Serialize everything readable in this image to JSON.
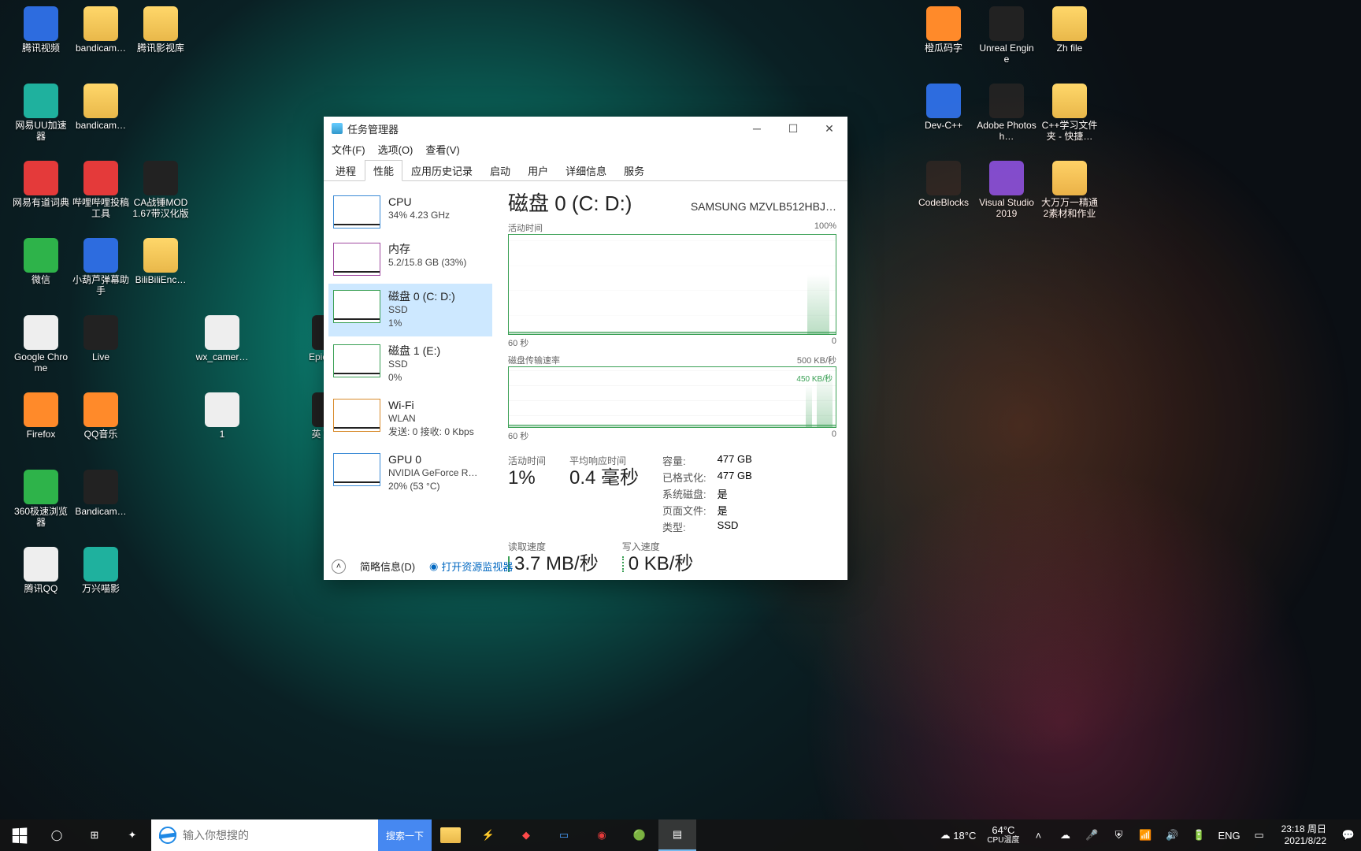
{
  "desktop_icons_left": [
    {
      "label": "腾讯视频",
      "cls": "blue"
    },
    {
      "label": "bandicam…",
      "cls": "folder"
    },
    {
      "label": "腾讯影视库",
      "cls": "folder"
    },
    {
      "label": "网易UU加速器",
      "cls": "teal"
    },
    {
      "label": "bandicam…",
      "cls": "folder"
    },
    {
      "label": "网易有道词典",
      "cls": "red"
    },
    {
      "label": "哔哩哔哩投稿工具",
      "cls": "red"
    },
    {
      "label": "CA战锤MOD 1.67带汉化版",
      "cls": "dark"
    },
    {
      "label": "微信",
      "cls": "green"
    },
    {
      "label": "小葫芦弹幕助手",
      "cls": "blue"
    },
    {
      "label": "BiliBiliEnc…",
      "cls": "folder"
    },
    {
      "label": "Google Chrome",
      "cls": "white"
    },
    {
      "label": "Live",
      "cls": "dark"
    },
    {
      "label": "wx_camer…",
      "cls": "white"
    },
    {
      "label": "Epic La…",
      "cls": "dark"
    },
    {
      "label": "Firefox",
      "cls": "orange"
    },
    {
      "label": "QQ音乐",
      "cls": "orange"
    },
    {
      "label": "1",
      "cls": "white"
    },
    {
      "label": "英 We…",
      "cls": "dark"
    },
    {
      "label": "360极速浏览器",
      "cls": "green"
    },
    {
      "label": "Bandicam…",
      "cls": "dark"
    },
    {
      "label": "腾讯QQ",
      "cls": "white"
    },
    {
      "label": "万兴喵影",
      "cls": "teal"
    }
  ],
  "desktop_icons_right": [
    {
      "label": "橙瓜码字",
      "cls": "orange"
    },
    {
      "label": "Unreal Engine",
      "cls": "dark"
    },
    {
      "label": "Zh file",
      "cls": "folder"
    },
    {
      "label": "Dev-C++",
      "cls": "blue"
    },
    {
      "label": "Adobe Photosh…",
      "cls": "dark"
    },
    {
      "label": "C++学习文件夹 - 快捷…",
      "cls": "folder"
    },
    {
      "label": "CodeBlocks",
      "cls": "dark"
    },
    {
      "label": "Visual Studio 2019",
      "cls": "purple"
    },
    {
      "label": "大万万一精通2素材和作业",
      "cls": "folder"
    }
  ],
  "tm": {
    "title": "任务管理器",
    "menu": [
      "文件(F)",
      "选项(O)",
      "查看(V)"
    ],
    "tabs": [
      "进程",
      "性能",
      "应用历史记录",
      "启动",
      "用户",
      "详细信息",
      "服务"
    ],
    "active_tab": 1,
    "list": [
      {
        "title": "CPU",
        "sub": "34%  4.23 GHz",
        "thumb": "c-blue"
      },
      {
        "title": "内存",
        "sub": "5.2/15.8 GB (33%)",
        "thumb": "c-pur"
      },
      {
        "title": "磁盘 0 (C: D:)",
        "sub": "SSD",
        "sub2": "1%",
        "thumb": "c-grn",
        "selected": true
      },
      {
        "title": "磁盘 1 (E:)",
        "sub": "SSD",
        "sub2": "0%",
        "thumb": "c-grn"
      },
      {
        "title": "Wi-Fi",
        "sub": "WLAN",
        "sub2": "发送: 0 接收: 0 Kbps",
        "thumb": "c-org"
      },
      {
        "title": "GPU 0",
        "sub": "NVIDIA GeForce R…",
        "sub2": "20% (53 °C)",
        "thumb": "c-blue"
      }
    ],
    "detail": {
      "heading": "磁盘 0 (C: D:)",
      "model": "SAMSUNG MZVLB512HBJ…",
      "g1": {
        "label": "活动时间",
        "max": "100%",
        "xl": "60 秒",
        "xr": "0"
      },
      "g2": {
        "label": "磁盘传输速率",
        "max": "500 KB/秒",
        "inner": "450 KB/秒",
        "xl": "60 秒",
        "xr": "0"
      },
      "stat1": {
        "label": "活动时间",
        "value": "1%"
      },
      "stat2": {
        "label": "平均响应时间",
        "value": "0.4 毫秒"
      },
      "stat3": {
        "label": "读取速度",
        "value": "3.7 MB/秒"
      },
      "stat4": {
        "label": "写入速度",
        "value": "0 KB/秒"
      },
      "grid": [
        [
          "容量:",
          "477 GB"
        ],
        [
          "已格式化:",
          "477 GB"
        ],
        [
          "系统磁盘:",
          "是"
        ],
        [
          "页面文件:",
          "是"
        ],
        [
          "类型:",
          "SSD"
        ]
      ]
    },
    "less": "简略信息(D)",
    "resmon": "打开资源监视器"
  },
  "taskbar": {
    "search_placeholder": "输入你想搜的",
    "search_btn": "搜索一下",
    "weather_temp": "18°C",
    "gpu_temp": "64°C",
    "gpu_label": "CPU温度",
    "lang": "ENG",
    "time": "23:18 周日",
    "date": "2021/8/22"
  }
}
